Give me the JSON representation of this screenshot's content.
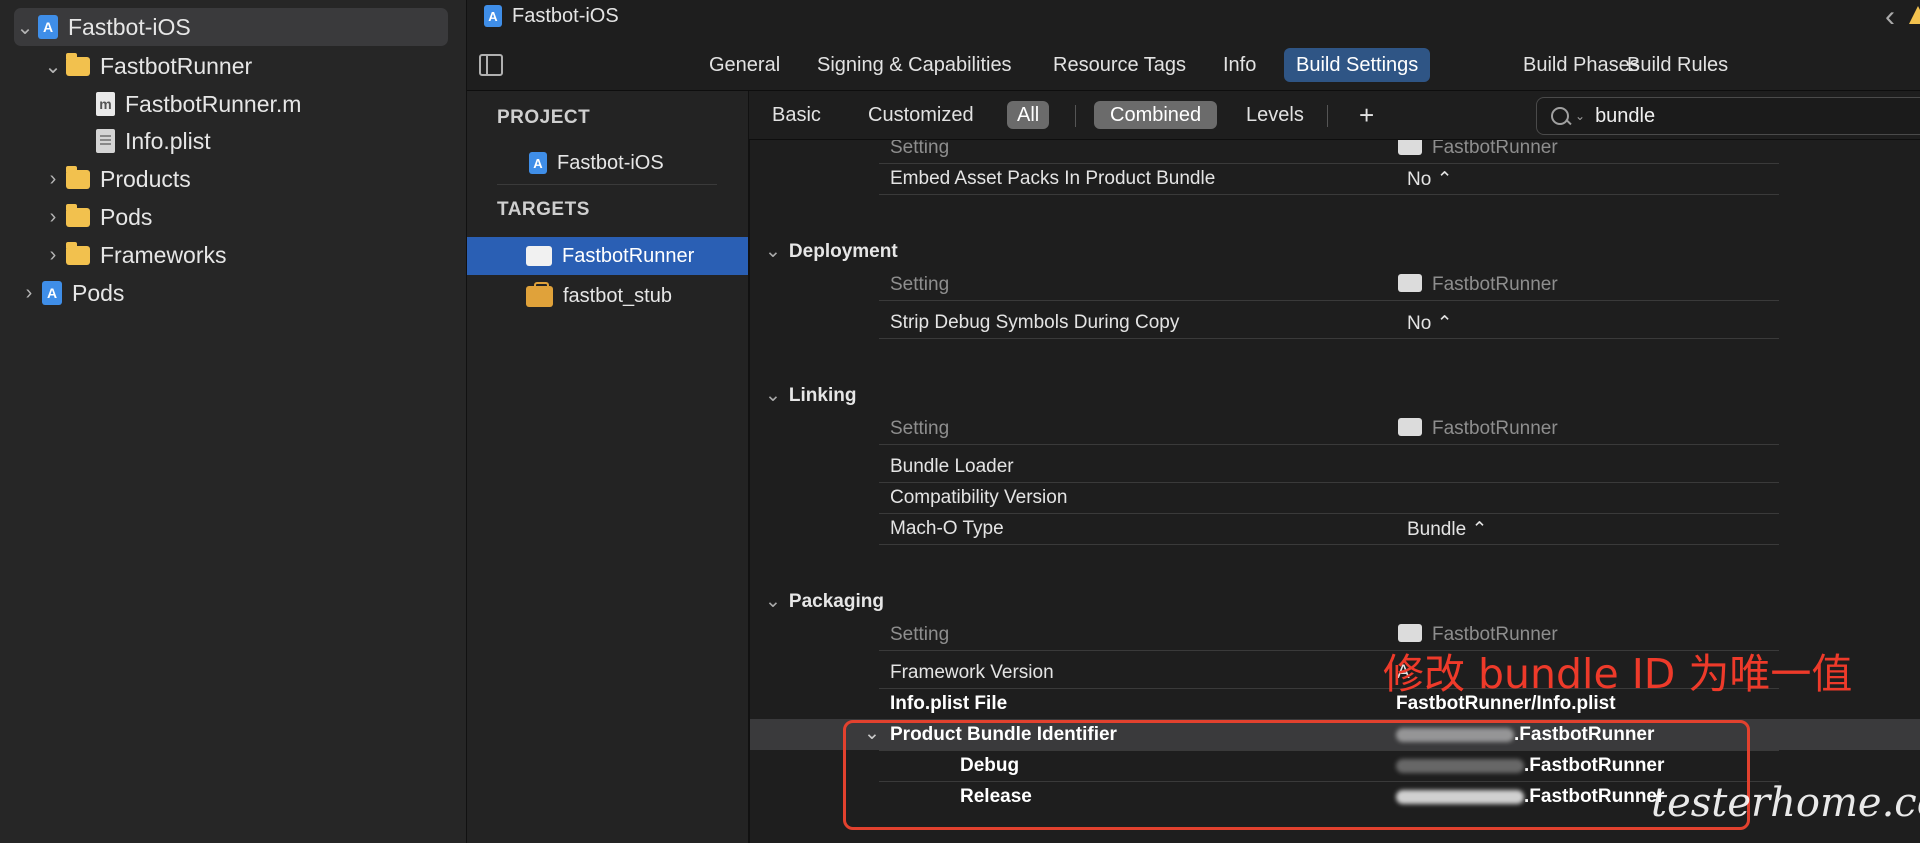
{
  "navigator": {
    "items": [
      {
        "label": "Fastbot-iOS",
        "chevron": "⌄"
      },
      {
        "label": "FastbotRunner",
        "chevron": "⌄"
      },
      {
        "label": "FastbotRunner.m",
        "icon_letter": "m"
      },
      {
        "label": "Info.plist"
      },
      {
        "label": "Products",
        "chevron": "›"
      },
      {
        "label": "Pods",
        "chevron": "›"
      },
      {
        "label": "Frameworks",
        "chevron": "›"
      },
      {
        "label": "Pods",
        "chevron": "›"
      }
    ]
  },
  "titlebar": {
    "title": "Fastbot-iOS",
    "back_glyph": "‹"
  },
  "tabs": [
    "General",
    "Signing & Capabilities",
    "Resource Tags",
    "Info",
    "Build Settings",
    "Build Phases",
    "Build Rules"
  ],
  "targets_panel": {
    "project_header": "PROJECT",
    "project_item": "Fastbot-iOS",
    "targets_header": "TARGETS",
    "targets": [
      "FastbotRunner",
      "fastbot_stub"
    ]
  },
  "filterbar": {
    "basic": "Basic",
    "customized": "Customized",
    "all": "All",
    "combined": "Combined",
    "levels": "Levels",
    "add": "+",
    "search_value": "bundle"
  },
  "settings": {
    "top_partial": {
      "setting_label": "Setting",
      "target": "FastbotRunner"
    },
    "embed_asset": {
      "name": "Embed Asset Packs In Product Bundle",
      "value": "No ⌃"
    },
    "groups": {
      "deployment": {
        "title": "Deployment",
        "setting_label": "Setting",
        "target": "FastbotRunner",
        "rows": [
          {
            "name": "Strip Debug Symbols During Copy",
            "value": "No ⌃"
          }
        ]
      },
      "linking": {
        "title": "Linking",
        "setting_label": "Setting",
        "target": "FastbotRunner",
        "rows": [
          {
            "name": "Bundle Loader",
            "value": ""
          },
          {
            "name": "Compatibility Version",
            "value": ""
          },
          {
            "name": "Mach-O Type",
            "value": "Bundle ⌃"
          }
        ]
      },
      "packaging": {
        "title": "Packaging",
        "setting_label": "Setting",
        "target": "FastbotRunner",
        "rows": [
          {
            "name": "Framework Version",
            "value": "A"
          },
          {
            "name": "Info.plist File",
            "value": "FastbotRunner/Info.plist"
          },
          {
            "name": "Product Bundle Identifier",
            "value": ".FastbotRunner"
          },
          {
            "name": "Debug",
            "value": ".FastbotRunner"
          },
          {
            "name": "Release",
            "value": ".FastbotRunner"
          }
        ]
      }
    }
  },
  "annotation": "修改 bundle ID 为唯一值",
  "watermark": "testerhome.com",
  "colors": {
    "accent": "#2f5585",
    "selection": "#2a5fb4",
    "annotation": "#e2412e"
  }
}
